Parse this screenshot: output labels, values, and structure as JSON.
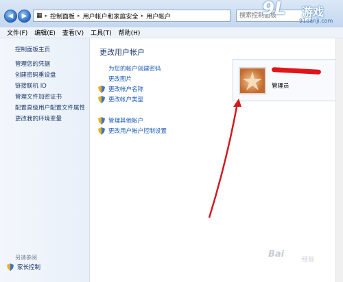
{
  "titlebar": {
    "breadcrumb": [
      "控制面板",
      "用户帐户和家庭安全",
      "用户帐户"
    ],
    "search_placeholder": "搜索控制面板"
  },
  "watermark": {
    "logo": "9L",
    "cn": "游戏",
    "url": "91danji.com"
  },
  "menu": [
    "文件(F)",
    "编辑(E)",
    "查看(V)",
    "工具(T)",
    "帮助(H)"
  ],
  "left": {
    "home": "控制面板主页",
    "items": [
      "管理您的凭据",
      "创建密码重设盘",
      "链接联机 ID",
      "管理文件加密证书",
      "配置高级用户配置文件属性",
      "更改我的环境变量"
    ],
    "see_also": "另请参阅",
    "parental": "家长控制"
  },
  "main": {
    "heading": "更改用户帐户",
    "links": [
      "为您的帐户创建密码",
      "更改图片"
    ],
    "shield_links": [
      "更改帐户名称",
      "更改帐户类型"
    ],
    "shield_links2": [
      "管理其他帐户",
      "更改用户帐户控制设置"
    ]
  },
  "account": {
    "role": "管理员"
  },
  "baidu": {
    "text": "Bai",
    "text2": "经验"
  }
}
